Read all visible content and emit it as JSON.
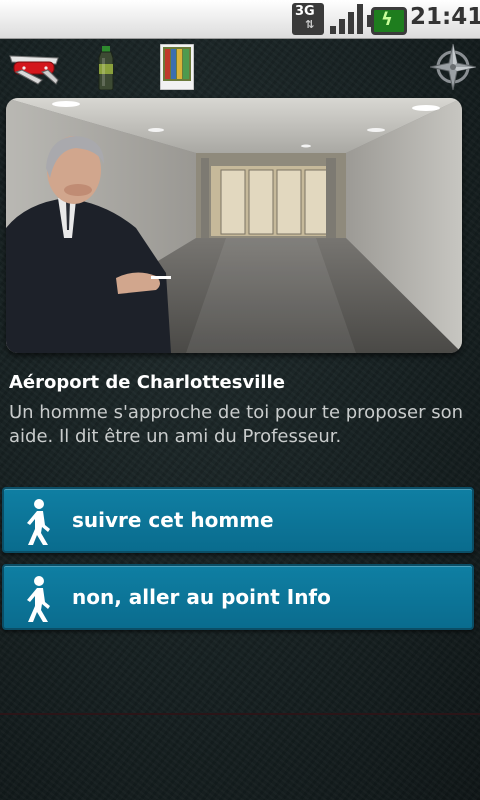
{
  "status_bar": {
    "network": "3G",
    "time": "21:41"
  },
  "toolbar": {
    "icons": [
      "swiss-knife-icon",
      "bottle-icon",
      "photo-icon",
      "compass-icon"
    ]
  },
  "scene": {
    "title": "Aéroport de Charlottesville",
    "description": "Un homme s'approche de toi pour te proposer son aide. Il dit être un ami du Professeur."
  },
  "choices": [
    {
      "label": "suivre cet homme",
      "icon": "walk-icon"
    },
    {
      "label": "non, aller au point Info",
      "icon": "walk-icon"
    }
  ],
  "colors": {
    "button": "#0a789e",
    "background": "#162021"
  }
}
